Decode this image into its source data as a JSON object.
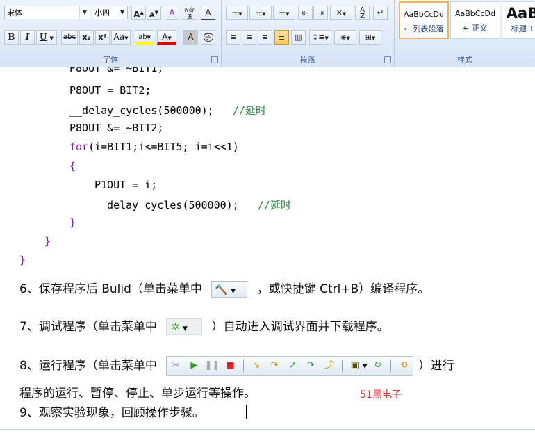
{
  "ribbon": {
    "font_group": {
      "label": "字体",
      "font_name": "宋体",
      "font_size": "小四",
      "grow_font": "A",
      "shrink_font": "A",
      "clear_format": "A",
      "phonetic": "wén",
      "char_border": "A",
      "bold": "B",
      "italic": "I",
      "underline": "U",
      "strikethrough": "abc",
      "subscript": "x₂",
      "superscript": "x²",
      "change_case": "Aa",
      "highlight": "ab",
      "font_color": "A",
      "char_shading": "A",
      "enclose_char": "字"
    },
    "paragraph_group": {
      "label": "段落"
    },
    "styles_group": {
      "label": "样式",
      "styles": [
        {
          "sample": "AaBbCcDd",
          "name": "↵ 列表段落"
        },
        {
          "sample": "AaBbCcDd",
          "name": "↵ 正文"
        },
        {
          "sample": "AaB",
          "name": "标题 1"
        }
      ]
    }
  },
  "code_lines": [
    "P8OUT &= ~BIT1;",
    "P8OUT = BIT2;",
    "__delay_cycles(500000);",
    "//延时",
    "P8OUT &= ~BIT2;",
    "for",
    "(i=BIT1;i<=BIT5; i=i<<1)",
    "{",
    "P1OUT = i;",
    "__delay_cycles(500000);",
    "//延时",
    "}",
    "}",
    "}"
  ],
  "steps": {
    "step6_a": "6、保存程序后 Bulid（单击菜单中",
    "step6_b": "，或快捷键 Ctrl+B）编译程序。",
    "step7_a": "7、调试程序（单击菜单中",
    "step7_b": "）自动进入调试界面并下载程序。",
    "step8_a": "8、运行程序（单击菜单中",
    "step8_b": "）进行",
    "step8_c": "程序的运行、暂停、停止、单步运行等操作。",
    "step9": "9、观察实验现象，回顾操作步骤。"
  },
  "watermark": "51黑电子",
  "colors": {
    "keyword": "#8b1dba",
    "comment": "#1e8a3c",
    "watermark": "#e03030"
  }
}
